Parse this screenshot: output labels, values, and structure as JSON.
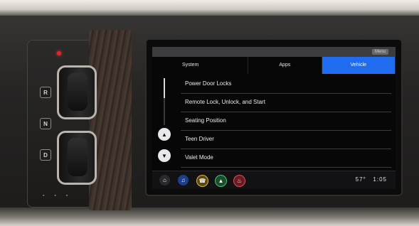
{
  "screen": {
    "tabs": [
      {
        "label": "System"
      },
      {
        "label": "Apps"
      },
      {
        "label": "Vehicle"
      }
    ],
    "status_pill": "Menu",
    "menu_items": [
      {
        "label": "Power Door Locks"
      },
      {
        "label": "Remote Lock, Unlock, and Start"
      },
      {
        "label": "Seating Position"
      },
      {
        "label": "Teen Driver"
      },
      {
        "label": "Valet Mode"
      }
    ],
    "scroll_position": 0.3,
    "dock": {
      "temperature": "57°",
      "time": "1:05",
      "icons": [
        "home-icon",
        "music-icon",
        "phone-icon",
        "navigation-icon",
        "climate-icon"
      ]
    }
  },
  "shifter": {
    "labels": [
      "R",
      "N",
      "D"
    ],
    "indicator_color": "#e6242b"
  },
  "colors": {
    "accent": "#1f6cf0",
    "screen_bg": "#070708"
  }
}
